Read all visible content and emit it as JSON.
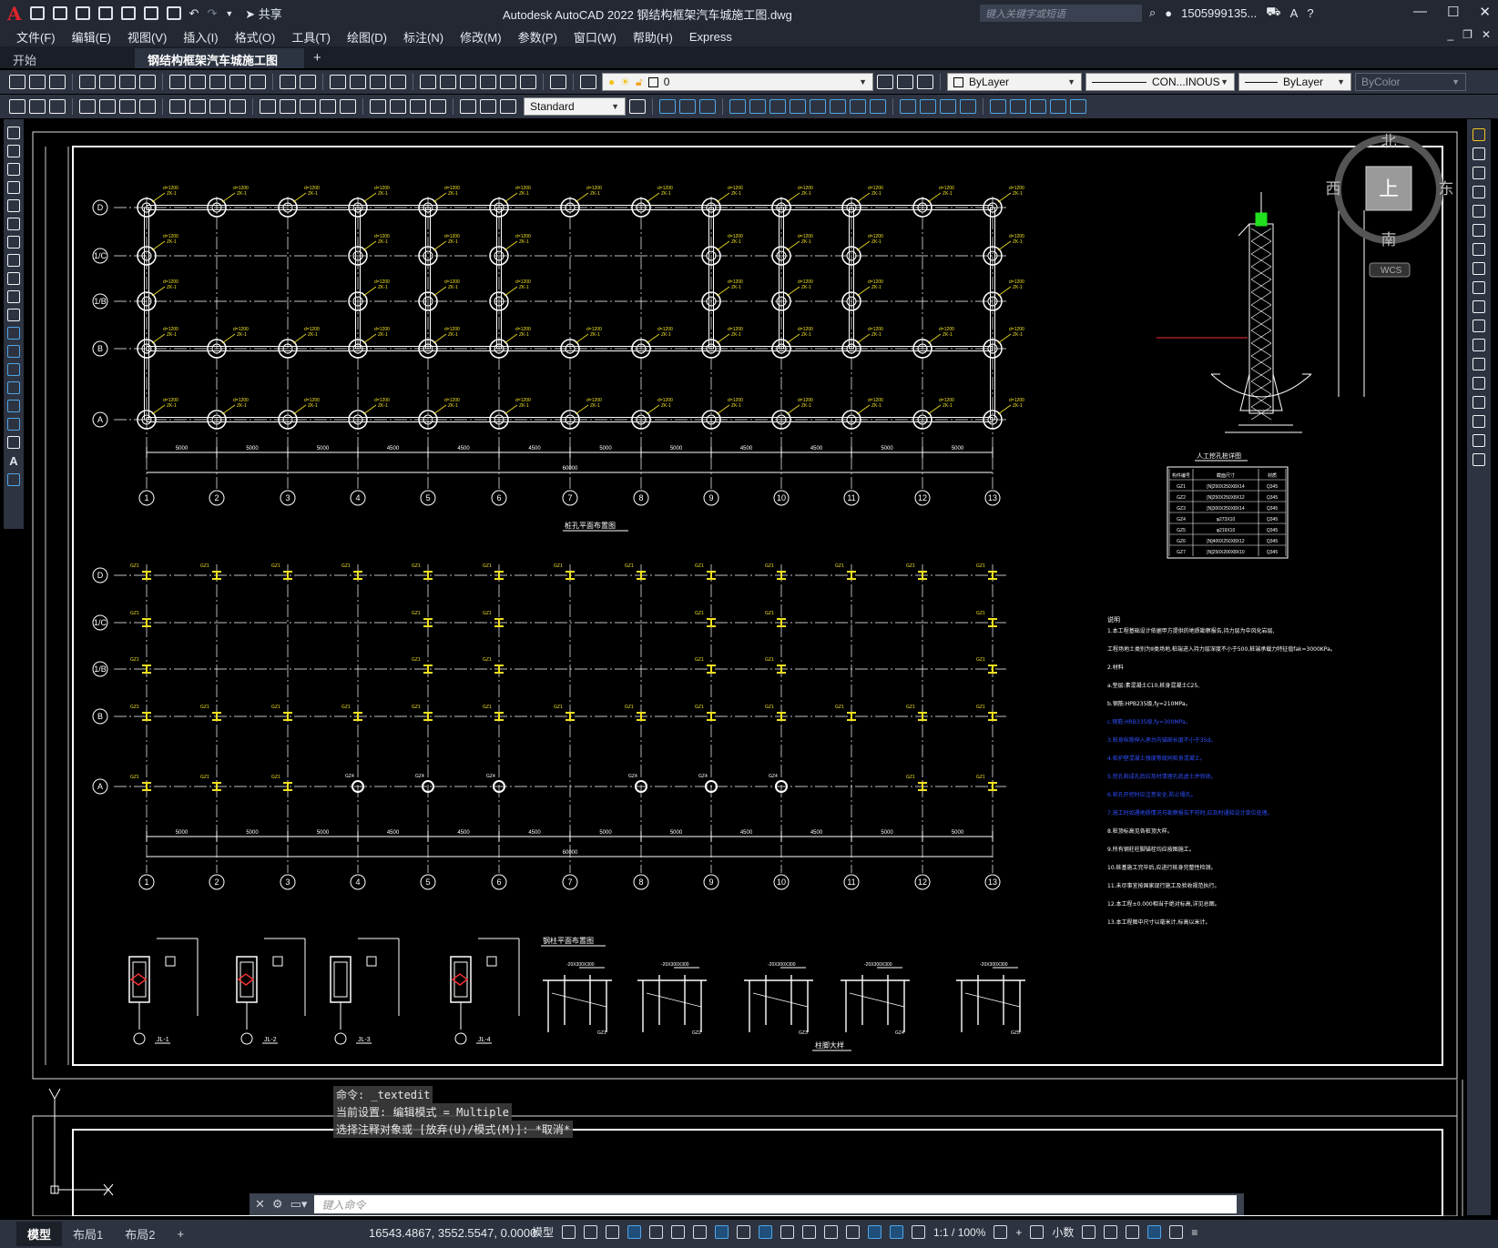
{
  "app": {
    "title": "Autodesk AutoCAD 2022    钢结构框架汽车城施工图.dwg",
    "share_label": "共享",
    "search_placeholder": "键入关键字或短语",
    "user": "1505999135...",
    "menu": [
      "文件(F)",
      "编辑(E)",
      "视图(V)",
      "插入(I)",
      "格式(O)",
      "工具(T)",
      "绘图(D)",
      "标注(N)",
      "修改(M)",
      "参数(P)",
      "窗口(W)",
      "帮助(H)",
      "Express"
    ],
    "tabs": [
      {
        "label": "开始",
        "active": false
      },
      {
        "label": "钢结构框架汽车城施工图*",
        "active": true
      }
    ]
  },
  "toolbar": {
    "layer_value": "0",
    "color_value": "ByLayer",
    "linetype_value": "CON...INOUS",
    "lineweight_value": "ByLayer",
    "plotstyle_value": "ByColor",
    "textstyle_value": "Standard"
  },
  "viewcube": {
    "north": "北",
    "south": "南",
    "west": "西",
    "east": "东",
    "top": "上",
    "wcs": "WCS"
  },
  "drawing": {
    "axes_numbers": [
      "1",
      "2",
      "3",
      "4",
      "5",
      "6",
      "7",
      "8",
      "9",
      "10",
      "11",
      "12",
      "13"
    ],
    "axes_letters": [
      "D",
      "1/C",
      "1/B",
      "B",
      "A"
    ],
    "dims": [
      "5000",
      "5000",
      "5000",
      "4500",
      "4500",
      "4500",
      "5000",
      "5000",
      "4500",
      "4500",
      "5000",
      "5000",
      "5000"
    ],
    "total_dim": "60000",
    "plan1_title": "桩孔平面布置图",
    "plan2_title": "钢柱平面布置图",
    "detail_title": "柱脚大样",
    "pile_title": "人工挖孔桩详图",
    "notes_title": "说明",
    "notes": [
      "1.本工程基础设计依据甲方提供的地质勘察报告,持力层为中风化岩层,",
      "  工程场地土类别为Ⅱ类场地,桩端进入持力层深度不小于500,桩端承载力特征值fak=3000KPa。",
      "2.材料",
      "  a.垫层:素混凝土C10,桩身混凝土C25,",
      "  b.钢筋:HPB235级,fy=210MPa。",
      "  c.钢筋:HRB335级,fy=300MPa。",
      "3.桩身纵筋伸入承台内锚固长度不小于35d。",
      "4.桩护壁混凝土强度等级同桩身混凝土。",
      "5.挖孔桩成孔后应及时清理孔底虚土并验收。",
      "6.桩孔开挖时应注意安全,防止塌孔。",
      "7.施工时如遇地质情况与勘察报告不符时,应及时通知设计单位处理。",
      "8.桩顶标高见各桩顶大样。",
      "9.所有钢柱柱脚锚栓均应按图施工。",
      "10.桩基施工完毕后,应进行桩身完整性检测。",
      "11.未尽事宜按国家现行施工及验收规范执行。",
      "12.本工程±0.000相当于绝对标高,详见总图。",
      "13.本工程图中尺寸以毫米计,标高以米计。"
    ],
    "table": {
      "headers": [
        "构件编号",
        "截面尺寸",
        "材质"
      ],
      "rows": [
        [
          "GZ1",
          "[N]250X250X8X14",
          "Q345"
        ],
        [
          "GZ2",
          "[N]250X250X8X12",
          "Q345"
        ],
        [
          "GZ3",
          "[N]300X250X8X14",
          "Q345"
        ],
        [
          "GZ4",
          "φ273X10",
          "Q345"
        ],
        [
          "GZ5",
          "φ219X10",
          "Q345"
        ],
        [
          "GZ6",
          "[N]400X250X8X12",
          "Q345"
        ],
        [
          "GZ7",
          "[N]250X200X8X10",
          "Q345"
        ]
      ]
    },
    "beam_labels": [
      "JL-1",
      "JL-2",
      "JL-3",
      "JL-4"
    ],
    "column_detail_labels": [
      "GZ1",
      "GZ2",
      "GZ3",
      "GZ4",
      "GZ5"
    ]
  },
  "command": {
    "history": [
      "命令: _textedit",
      "当前设置: 编辑模式 = Multiple",
      "选择注释对象或 [放弃(U)/模式(M)]: *取消*"
    ],
    "placeholder": "键入命令"
  },
  "status": {
    "layout_tabs": [
      "模型",
      "布局1",
      "布局2"
    ],
    "coords": "16543.4867, 3552.5547, 0.0000",
    "model_label": "模型",
    "scale": "1:1 / 100%",
    "units": "小数"
  },
  "colors": {
    "accent": "#4fa6e8",
    "bg": "#000000",
    "ui": "#2d3340",
    "title": "#232833",
    "yellow": "#f0e020",
    "blue": "#3050ff"
  }
}
